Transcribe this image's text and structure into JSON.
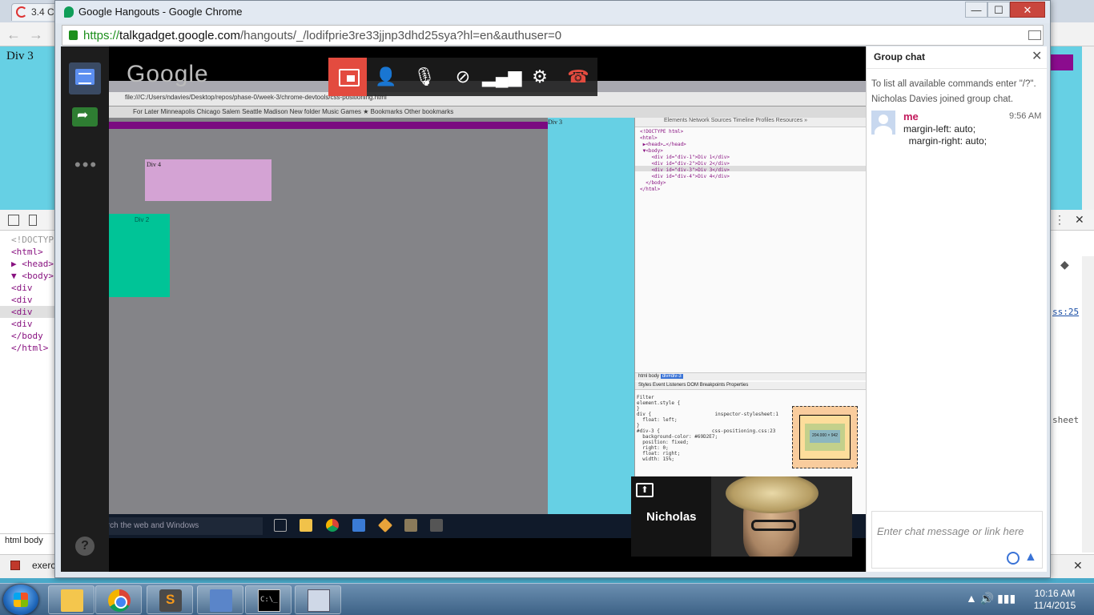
{
  "background_window": {
    "tab_title": "3.4 C",
    "page_text": "Div 3",
    "devtools_code": [
      {
        "text": "<!DOCTYPE",
        "kind": "cmt"
      },
      {
        "text": "<html>",
        "kind": "tag"
      },
      {
        "text": "▶ <head>",
        "kind": "tag"
      },
      {
        "text": "▼ <body>",
        "kind": "tag"
      },
      {
        "text": "  <div",
        "kind": "tag"
      },
      {
        "text": "  <div",
        "kind": "tag"
      },
      {
        "text": "  <div",
        "kind": "tag-hl"
      },
      {
        "text": "  <div",
        "kind": "tag"
      },
      {
        "text": "  </body",
        "kind": "tag"
      },
      {
        "text": "</html>",
        "kind": "tag"
      }
    ],
    "breadcrumbs": "html   body",
    "right_link": "ss:25",
    "right_label": "sheet",
    "bottom_tab": "exerc"
  },
  "hangouts_window": {
    "title": "Google Hangouts - Google Chrome",
    "url_scheme": "https://",
    "url_host": "talkgadget.google.com",
    "url_path": "/hangouts/_/lodifprie3re33jjnp3dhd25sya?hl=en&authuser=0",
    "minimize": "—",
    "maximize": "☐",
    "close": "✕"
  },
  "call": {
    "logo_text": "Google",
    "controls": [
      {
        "name": "screen-share-pip-button",
        "glyph": ""
      },
      {
        "name": "invite-people-button",
        "glyph": "👤"
      },
      {
        "name": "mute-mic-button",
        "glyph": "🎙"
      },
      {
        "name": "video-off-button",
        "glyph": "⊘"
      },
      {
        "name": "bandwidth-button",
        "glyph": "▂▄▆"
      },
      {
        "name": "settings-button",
        "glyph": "⚙"
      },
      {
        "name": "hang-up-button",
        "glyph": "☎"
      }
    ],
    "rail_more": "•••",
    "help": "?",
    "participant_name": "Nicholas",
    "upload_glyph": "⬆"
  },
  "shared_screen": {
    "url": "file:///C:/Users/ndavies/Desktop/repos/phase-0/week-3/chrome-devtools/css-positioning.html",
    "bookmarks": "For Later   Minneapolis   Chicago   Salem   Seattle   Madison   New folder   Music   Games   ★ Bookmarks                                                                                             Other bookmarks",
    "div4_label": "Div 4",
    "div2_label": "Div 2",
    "div3_label": "Div 3",
    "devtools_tabs": "Elements   Network   Sources   Timeline   Profiles   Resources   »",
    "devtools_code": "<!DOCTYPE html>\n<html>\n ▶<head>…</head>\n ▼<body>\n    <div id=\"div-1\">Div 1</div>\n    <div id=\"div-2\">Div 2</div>\n    <div id=\"div-3\">Div 3</div>\n    <div id=\"div-4\">Div 4</div>\n  </body>\n</html>",
    "crumbs_plain": "html  body  ",
    "crumb_selected": "div#div-3",
    "styles_tabs": "Styles   Event Listeners   DOM Breakpoints   Properties",
    "rules": "Filter\nelement.style {\n}\ndiv {                      inspector-stylesheet:1\n  float: left;\n}\n#div-3 {                  css-positioning.css:23\n  background-color: #69D2E7;\n  position: fixed;\n  right: 0;\n  float: right;\n  width: 15%;",
    "box_content": "204.000 × 942",
    "search_placeholder": "Search the web and Windows"
  },
  "chat": {
    "title": "Group chat",
    "close": "✕",
    "system_messages": [
      "To list all available commands enter \"/?\".",
      "Nicholas Davies joined group chat."
    ],
    "message": {
      "sender": "me",
      "time": "9:56 AM",
      "text": "margin-left: auto;\n  margin-right: auto;"
    },
    "input_placeholder": "Enter chat message or link here",
    "emoji_icon": "smiley-icon",
    "drive_glyph": "▲"
  },
  "taskbar": {
    "tray": "▲  🔊  ▮▮▮",
    "time": "10:16 AM",
    "date": "11/4/2015"
  }
}
